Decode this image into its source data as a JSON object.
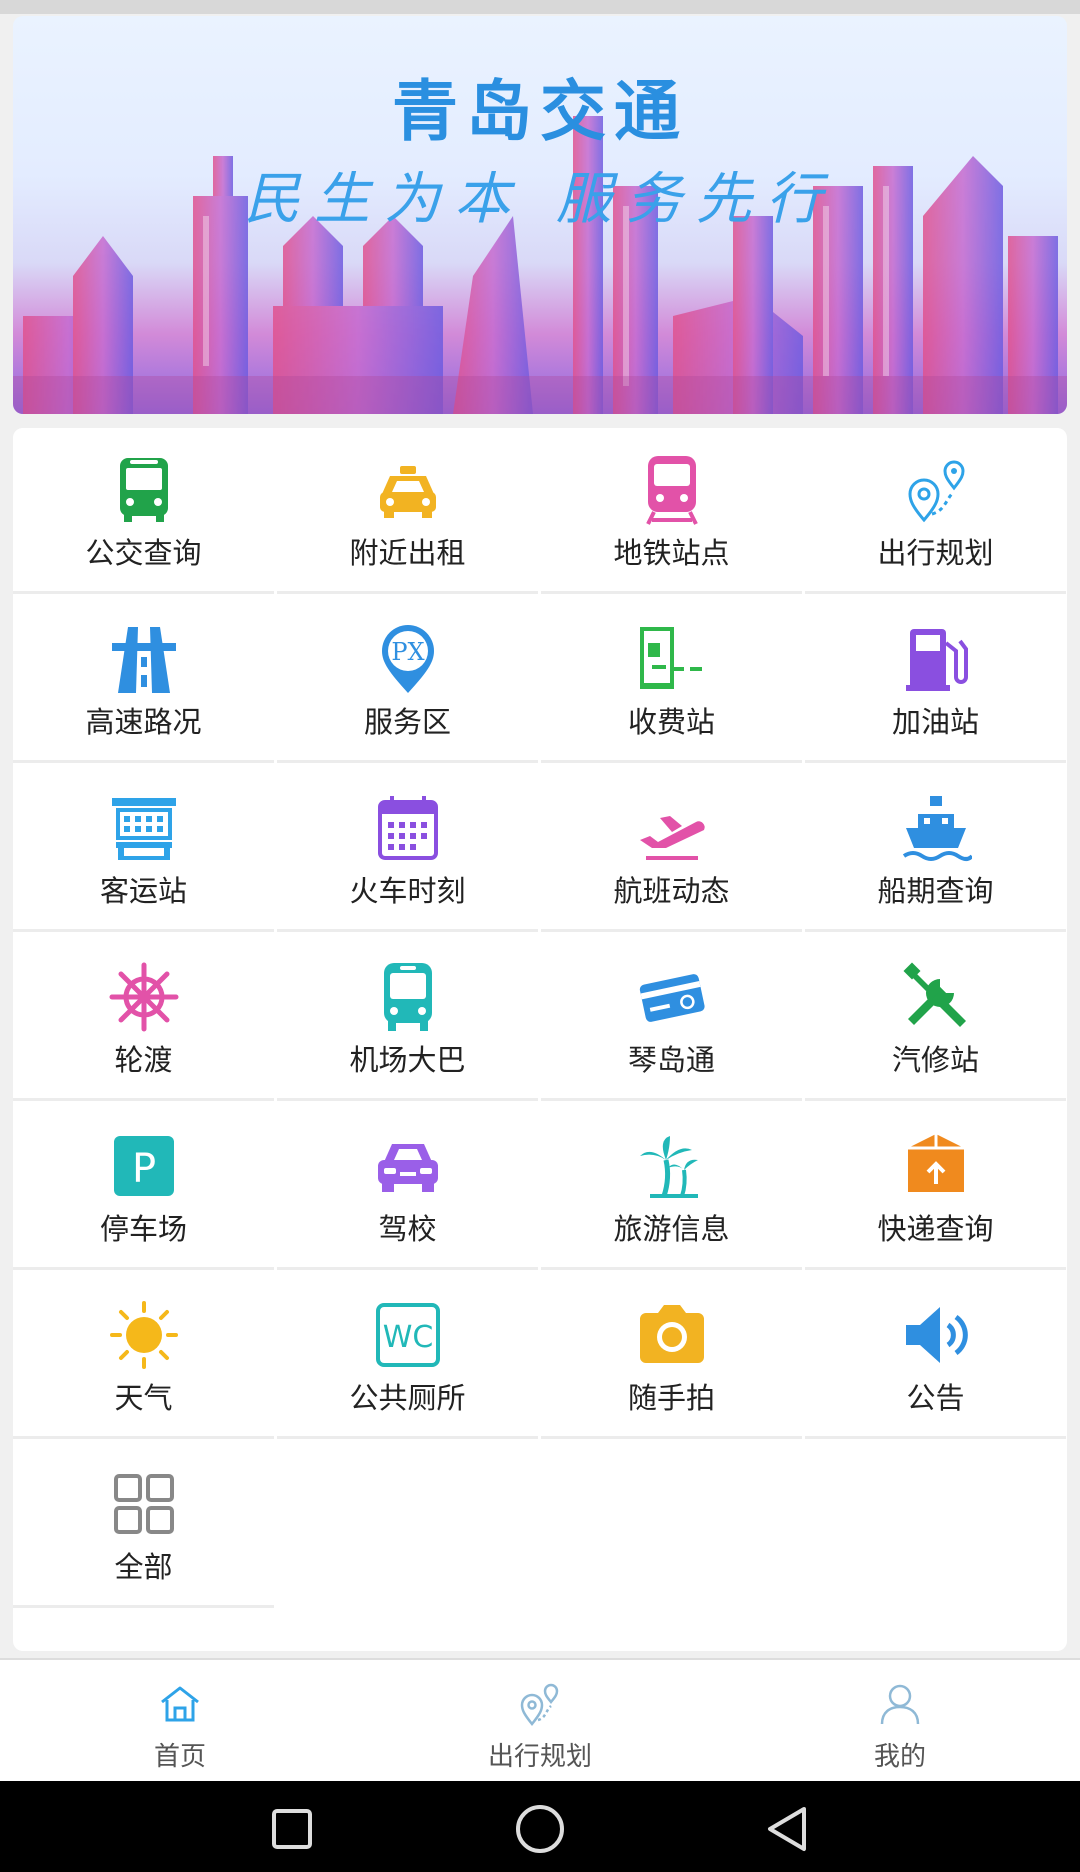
{
  "banner": {
    "title": "青岛交通",
    "slogan": "民生为本  服务先行"
  },
  "grid": {
    "items": [
      {
        "label": "公交查询",
        "icon": "bus-icon",
        "color": "#21a34a"
      },
      {
        "label": "附近出租",
        "icon": "taxi-icon",
        "color": "#f2b322"
      },
      {
        "label": "地铁站点",
        "icon": "subway-icon",
        "color": "#e252a8"
      },
      {
        "label": "出行规划",
        "icon": "route-pin-icon",
        "color": "#2ea3e8"
      },
      {
        "label": "高速路况",
        "icon": "highway-icon",
        "color": "#2f8fe0"
      },
      {
        "label": "服务区",
        "icon": "service-area-pin-icon",
        "color": "#2f8fe0"
      },
      {
        "label": "收费站",
        "icon": "toll-station-icon",
        "color": "#2fb84a"
      },
      {
        "label": "加油站",
        "icon": "gas-pump-icon",
        "color": "#8a4fe0"
      },
      {
        "label": "客运站",
        "icon": "bus-station-icon",
        "color": "#2ea3e8"
      },
      {
        "label": "火车时刻",
        "icon": "calendar-icon",
        "color": "#8a4fe0"
      },
      {
        "label": "航班动态",
        "icon": "airplane-icon",
        "color": "#e252a8"
      },
      {
        "label": "船期查询",
        "icon": "ship-icon",
        "color": "#2f8fe0"
      },
      {
        "label": "轮渡",
        "icon": "ship-wheel-icon",
        "color": "#e252a8"
      },
      {
        "label": "机场大巴",
        "icon": "airport-bus-icon",
        "color": "#21b8b8"
      },
      {
        "label": "琴岛通",
        "icon": "card-icon",
        "color": "#2f8fe0"
      },
      {
        "label": "汽修站",
        "icon": "tools-icon",
        "color": "#21a34a"
      },
      {
        "label": "停车场",
        "icon": "parking-icon",
        "color": "#21b8b8"
      },
      {
        "label": "驾校",
        "icon": "car-icon",
        "color": "#9a5fe8"
      },
      {
        "label": "旅游信息",
        "icon": "palm-tree-icon",
        "color": "#21b8b8"
      },
      {
        "label": "快递查询",
        "icon": "package-icon",
        "color": "#f08a1e"
      },
      {
        "label": "天气",
        "icon": "sun-icon",
        "color": "#f5b81a"
      },
      {
        "label": "公共厕所",
        "icon": "wc-icon",
        "color": "#21b8b8"
      },
      {
        "label": "随手拍",
        "icon": "camera-icon",
        "color": "#f2b322"
      },
      {
        "label": "公告",
        "icon": "speaker-icon",
        "color": "#2f8fe0"
      },
      {
        "label": "全部",
        "icon": "grid-all-icon",
        "color": "#888888"
      }
    ]
  },
  "tabbar": {
    "tabs": [
      {
        "label": "首页",
        "icon": "home-icon"
      },
      {
        "label": "出行规划",
        "icon": "route-pin-icon"
      },
      {
        "label": "我的",
        "icon": "user-icon"
      }
    ],
    "active_color": "#2ea3e8"
  }
}
